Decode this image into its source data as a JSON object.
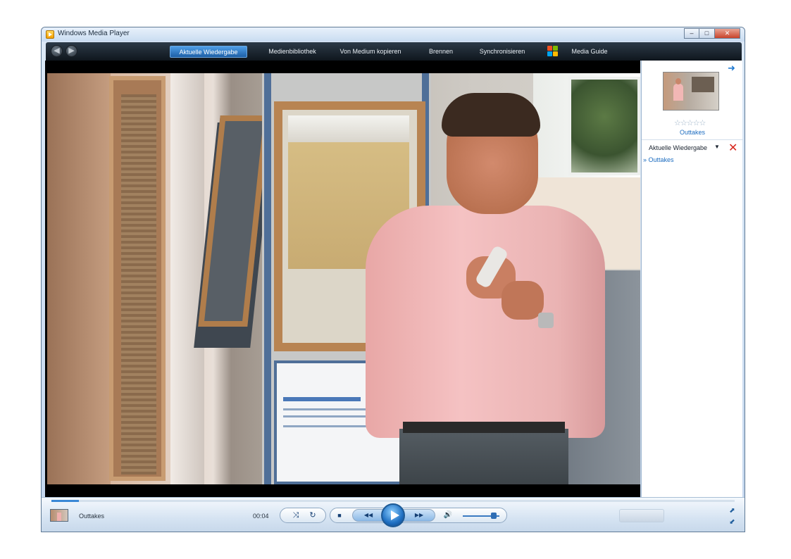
{
  "window": {
    "title": "Windows Media Player",
    "buttons": {
      "minimize": "–",
      "maximize": "□",
      "close": "✕"
    }
  },
  "nav": {
    "back": "◀",
    "forward": "▶",
    "tabs": [
      {
        "label": "Aktuelle Wiedergabe",
        "active": true
      },
      {
        "label": "Medienbibliothek",
        "active": false
      },
      {
        "label": "Von Medium kopieren",
        "active": false
      },
      {
        "label": "Brennen",
        "active": false
      },
      {
        "label": "Synchronisieren",
        "active": false
      },
      {
        "label": "Media Guide",
        "active": false
      }
    ]
  },
  "sidebar": {
    "arrow": "➜",
    "rating": "☆☆☆☆☆",
    "title": "Outtakes",
    "list_header": "Aktuelle Wiedergabe",
    "caret": "▼",
    "clear": "✕",
    "items": [
      "Outtakes"
    ]
  },
  "controls": {
    "now_playing": "Outtakes",
    "time": "00:04",
    "shuffle": "⤨",
    "repeat": "↻",
    "stop": "■",
    "prev": "◀◀",
    "next": "▶▶",
    "mute": "🔊",
    "seek_progress": 0.04,
    "volume": 0.85,
    "expand": "⬈",
    "compact": "⬋"
  },
  "colors": {
    "accent": "#1e6fc2",
    "navbar": "#1a242e",
    "link": "#1c6cc0"
  }
}
